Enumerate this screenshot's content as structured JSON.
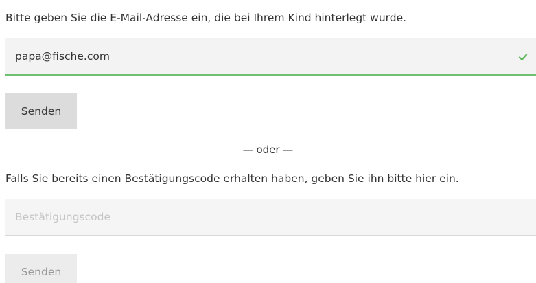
{
  "email_section": {
    "prompt": "Bitte geben Sie die E-Mail-Adresse ein, die bei Ihrem Kind hinterlegt wurde.",
    "email_value": "papa@fische.com",
    "send_label": "Senden"
  },
  "divider": {
    "label": "— oder —"
  },
  "code_section": {
    "prompt": "Falls Sie bereits einen Bestätigungscode erhalten haben, geben Sie ihn bitte hier ein.",
    "code_placeholder": "Bestätigungscode",
    "send_label": "Senden"
  },
  "colors": {
    "valid_accent": "#6cc06f",
    "field_background": "#f3f3f3",
    "button_background": "#dcdcdc"
  },
  "icons": {
    "valid": "check-icon"
  }
}
